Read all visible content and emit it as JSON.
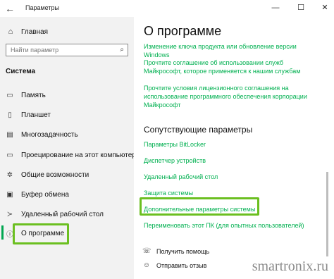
{
  "window": {
    "title": "Параметры",
    "back_icon": "←",
    "minimize": "—",
    "maximize": "☐",
    "close": "✕"
  },
  "sidebar": {
    "home_label": "Главная",
    "home_icon": "⌂",
    "search_placeholder": "Найти параметр",
    "search_icon": "⌕",
    "section_title": "Система",
    "items": [
      {
        "label": "Память",
        "icon": "▭"
      },
      {
        "label": "Планшет",
        "icon": "▯"
      },
      {
        "label": "Многозадачность",
        "icon": "▤"
      },
      {
        "label": "Проецирование на этот компьютер",
        "icon": "▭"
      },
      {
        "label": "Общие возможности",
        "icon": "✲"
      },
      {
        "label": "Буфер обмена",
        "icon": "▣"
      },
      {
        "label": "Удаленный рабочий стол",
        "icon": "≻"
      },
      {
        "label": "О программе",
        "icon": "ⓘ"
      }
    ]
  },
  "main": {
    "title": "О программе",
    "links": [
      "Изменение ключа продукта или обновление версии Windows",
      "Прочтите соглашение об использовании служб Майкрософт, которое применяется к нашим службам",
      "Прочтите условия лицензионного соглашения на использование программного обеспечения корпорации Майкрософт"
    ],
    "related_title": "Сопутствующие параметры",
    "related": [
      "Параметры BitLocker",
      "Диспетчер устройств",
      "Удаленный рабочий стол",
      "Защита системы",
      "Дополнительные параметры системы",
      "Переименовать этот ПК (для опытных пользователей)"
    ],
    "help": "Получить помощь",
    "help_icon": "☏",
    "feedback": "Отправить отзыв",
    "feedback_icon": "☺"
  },
  "watermark": "smartronix.ru",
  "colors": {
    "accent": "#00b050",
    "highlight": "#6bbf20",
    "sidebar_bg": "#f2f2f2"
  }
}
